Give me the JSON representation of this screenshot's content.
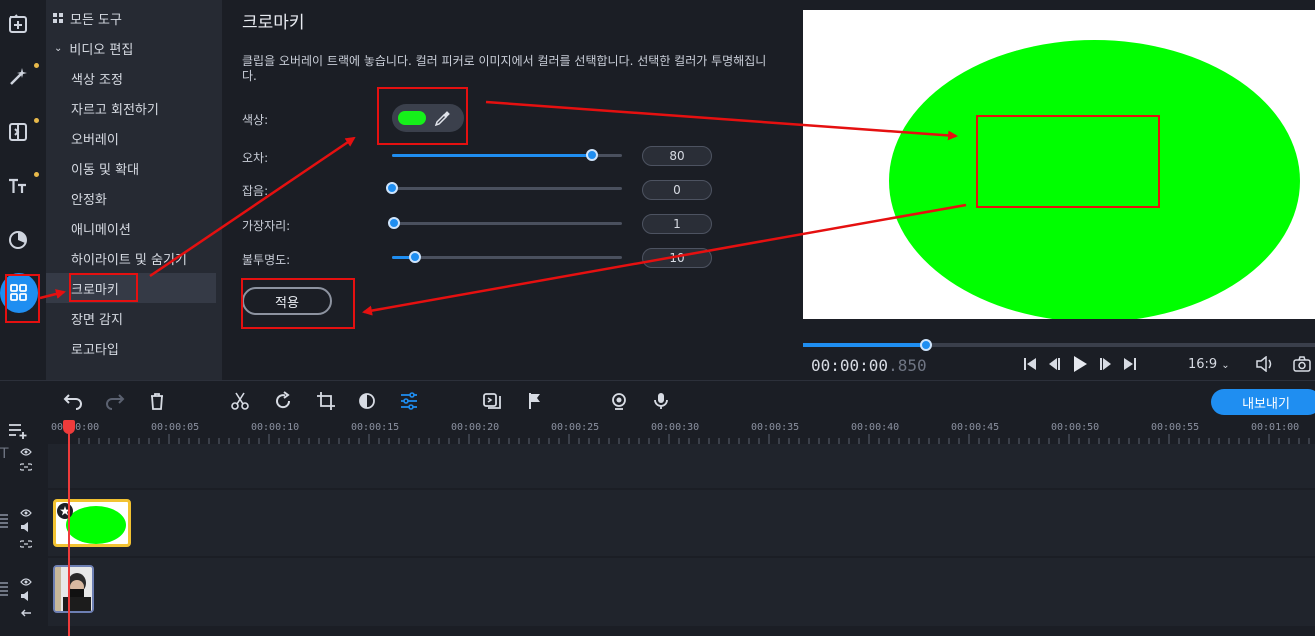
{
  "tool_list": {
    "items": [
      {
        "label": "모든 도구",
        "kind": "section",
        "selected": false
      },
      {
        "label": "비디오 편집",
        "kind": "section",
        "selected": false
      },
      {
        "label": "색상 조정",
        "kind": "item",
        "selected": false
      },
      {
        "label": "자르고 회전하기",
        "kind": "item",
        "selected": false
      },
      {
        "label": "오버레이",
        "kind": "item",
        "selected": false
      },
      {
        "label": "이동 및 확대",
        "kind": "item",
        "selected": false
      },
      {
        "label": "안정화",
        "kind": "item",
        "selected": false
      },
      {
        "label": "애니메이션",
        "kind": "item",
        "selected": false
      },
      {
        "label": "하이라이트 및 숨기기",
        "kind": "item",
        "selected": false
      },
      {
        "label": "크로마키",
        "kind": "item",
        "selected": true
      },
      {
        "label": "장면 감지",
        "kind": "item",
        "selected": false
      },
      {
        "label": "로고타입",
        "kind": "item",
        "selected": false
      }
    ]
  },
  "chroma_panel": {
    "title": "크로마키",
    "description": "클립을 오버레이 트랙에 놓습니다. 컬러 피커로 이미지에서 컬러를 선택합니다. 선택한 컬러가 투명해집니다.",
    "color_label": "색상:",
    "color_value": "#16f01a",
    "params": [
      {
        "label": "오차:",
        "value": "80",
        "fraction": 0.87
      },
      {
        "label": "잡음:",
        "value": "0",
        "fraction": 0.0
      },
      {
        "label": "가장자리:",
        "value": "1",
        "fraction": 0.01
      },
      {
        "label": "불투명도:",
        "value": "10",
        "fraction": 0.1
      }
    ],
    "apply_label": "적용"
  },
  "preview": {
    "timecode_main": "00:00:00",
    "timecode_ms": ".850",
    "progress": 0.24,
    "aspect_ratio": "16:9"
  },
  "timeline": {
    "export_label": "내보내기",
    "ruler_labels": [
      "00:00:00",
      "00:00:05",
      "00:00:10",
      "00:00:15",
      "00:00:20",
      "00:00:25",
      "00:00:30",
      "00:00:35",
      "00:00:40",
      "00:00:45",
      "00:00:50",
      "00:00:55",
      "00:01:00"
    ]
  },
  "colors": {
    "accent": "#1f8ef1",
    "annotation": "#e51010",
    "chroma_green": "#00ff00"
  }
}
